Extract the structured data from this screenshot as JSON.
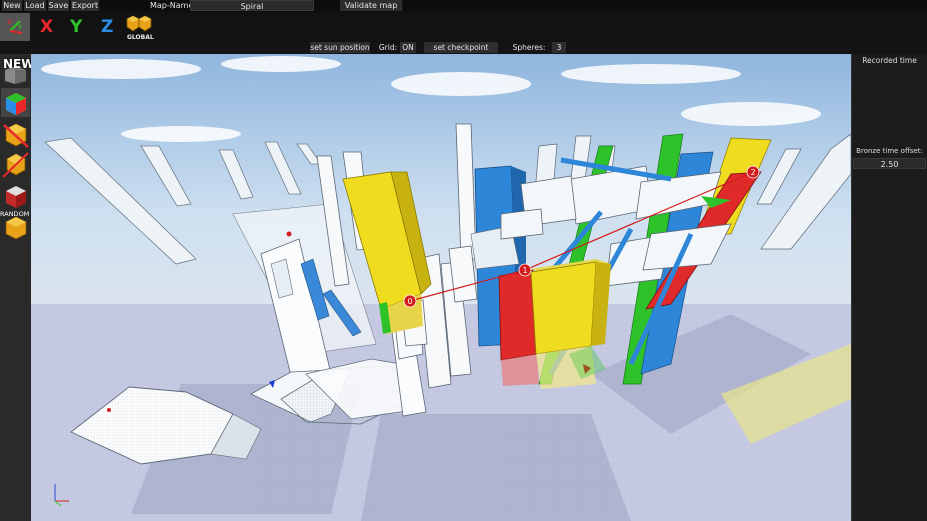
{
  "menu": {
    "new": "New",
    "load": "Load",
    "save": "Save",
    "export": "Export",
    "map_name_label": "Map-Name:",
    "map_name_value": "Spiral",
    "validate": "Validate map"
  },
  "toolbar": {
    "x": "X",
    "y": "Y",
    "z": "Z",
    "global_label": "GLOBAL",
    "colors": {
      "x": "#e8282a",
      "y": "#2ec22a",
      "z": "#2a8de8"
    }
  },
  "options": {
    "sun": "set sun position",
    "grid_label": "Grid:",
    "grid_value": "ON",
    "checkpoint": "set checkpoint path",
    "spheres_label": "Spheres:",
    "spheres_value": "3"
  },
  "tools": {
    "new_label": "NEW",
    "random_label": "RANDOM"
  },
  "panel": {
    "recorded_time": "Recorded time",
    "bronze_label": "Bronze time offset:",
    "bronze_value": "2.50"
  },
  "checkpoints": [
    "0",
    "1",
    "2"
  ]
}
